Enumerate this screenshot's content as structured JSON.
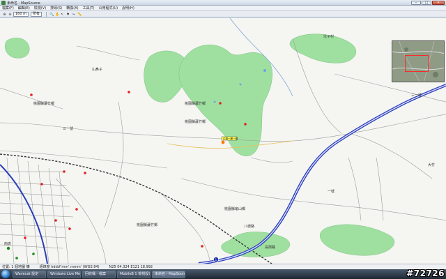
{
  "window": {
    "title": "未命名 - MapSource",
    "minimize": "–",
    "maximize": "□",
    "close": "✕"
  },
  "menu": [
    "檔案(F)",
    "編輯(E)",
    "檢視(V)",
    "搜尋(S)",
    "轉換(A)",
    "工具(T)",
    "公用程式(U)",
    "說明(H)"
  ],
  "toolbar": {
    "zoom_value": "160 m",
    "map_select": "所有"
  },
  "map_labels": {
    "area_1": "桃園縣蘆竹鄉",
    "area_2": "桃園縣蘆竹鄉",
    "area_3": "桃園縣蘆竹鄉",
    "area_4": "桃園縣龜山鄉",
    "area_5": "桃園縣蘆竹鄉",
    "road_1": "三一號",
    "road_2": "三一號",
    "road_3": "一號",
    "highway_marker": "1",
    "place_1": "南崁",
    "place_2": "山鼻子",
    "place_3": "坑子村",
    "place_4": "大竹",
    "place_5": "八德路",
    "place_6": "長興路",
    "selected_poi": "口湖一鄉一號"
  },
  "status": {
    "position": "位置: 1 個地圖 擴",
    "datum": "經緯度 hddd°mm'.mmm' (WGS 84)",
    "coords": "N25 04.324 E121 18.992"
  },
  "taskbar": {
    "tasks": [
      "Wavecat 設定",
      "Windows Live Mess...",
      "回收桶 - 檔案",
      "MobileB 1 檢視設定",
      "未命名 - MapSource"
    ]
  },
  "watermark": "#72726"
}
